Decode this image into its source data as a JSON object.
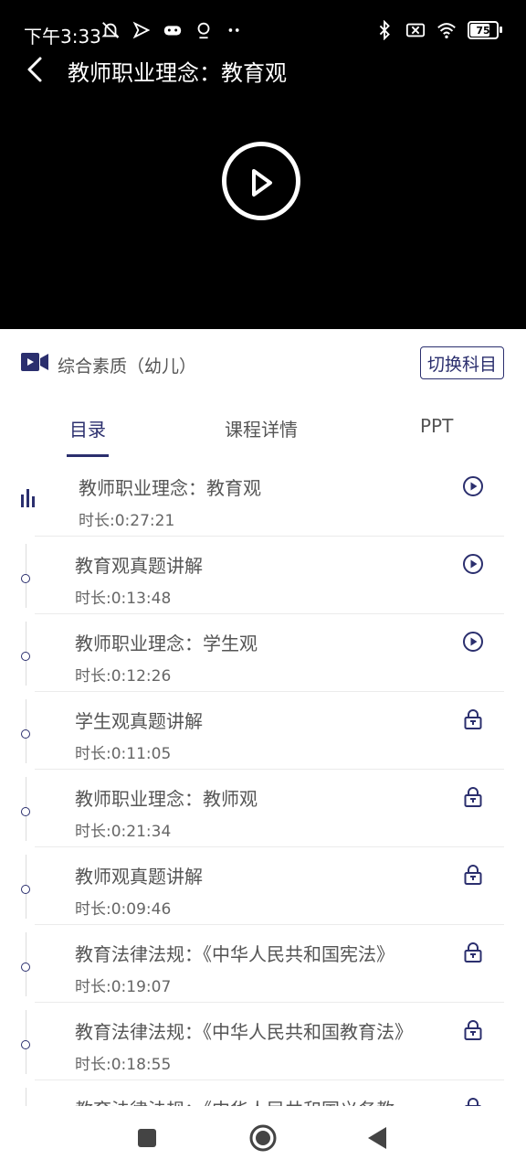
{
  "status_bar": {
    "time": "下午3:33",
    "battery_level": "75",
    "battery_fraction": 0.75,
    "left_icons": [
      "mute-bell-icon",
      "send-icon",
      "gamepad-icon",
      "location-icon",
      "more-dots-icon"
    ],
    "right_icons": [
      "bluetooth-icon",
      "sim-disabled-icon",
      "wifi-icon",
      "battery-icon"
    ]
  },
  "player": {
    "title": "教师职业理念：教育观",
    "back_icon": "back-arrow-icon",
    "play_icon": "play-circle-icon"
  },
  "subject": {
    "name": "综合素质（幼儿）",
    "icon": "video-camera-icon",
    "switch_label": "切换科目"
  },
  "tabs": [
    {
      "label": "目录",
      "active": true
    },
    {
      "label": "课程详情",
      "active": false
    },
    {
      "label": "PPT",
      "active": false
    }
  ],
  "lessons": [
    {
      "title": "教师职业理念：教育观",
      "duration": "时长:0:27:21",
      "status": "playing",
      "icon": "play-circle-icon"
    },
    {
      "title": "教育观真题讲解",
      "duration": "时长:0:13:48",
      "status": "free",
      "icon": "play-circle-icon"
    },
    {
      "title": "教师职业理念：学生观",
      "duration": "时长:0:12:26",
      "status": "free",
      "icon": "play-circle-icon"
    },
    {
      "title": "学生观真题讲解",
      "duration": "时长:0:11:05",
      "status": "locked",
      "icon": "lock-icon"
    },
    {
      "title": "教师职业理念：教师观",
      "duration": "时长:0:21:34",
      "status": "locked",
      "icon": "lock-icon"
    },
    {
      "title": "教师观真题讲解",
      "duration": "时长:0:09:46",
      "status": "locked",
      "icon": "lock-icon"
    },
    {
      "title": "教育法律法规：《中华人民共和国宪法》",
      "duration": "时长:0:19:07",
      "status": "locked",
      "icon": "lock-icon"
    },
    {
      "title": "教育法律法规：《中华人民共和国教育法》",
      "duration": "时长:0:18:55",
      "status": "locked",
      "icon": "lock-icon"
    },
    {
      "title": "教育法律法规：《中华人民共和国义务教",
      "duration": "",
      "status": "locked",
      "icon": "lock-icon"
    }
  ],
  "nav_bar": {
    "recents_icon": "square-recents-icon",
    "home_icon": "circle-home-icon",
    "back_icon": "triangle-back-icon"
  },
  "colors": {
    "accent": "#2b2f6e",
    "video_bg": "#000000",
    "text_primary": "#555555",
    "divider": "#ebebeb"
  }
}
